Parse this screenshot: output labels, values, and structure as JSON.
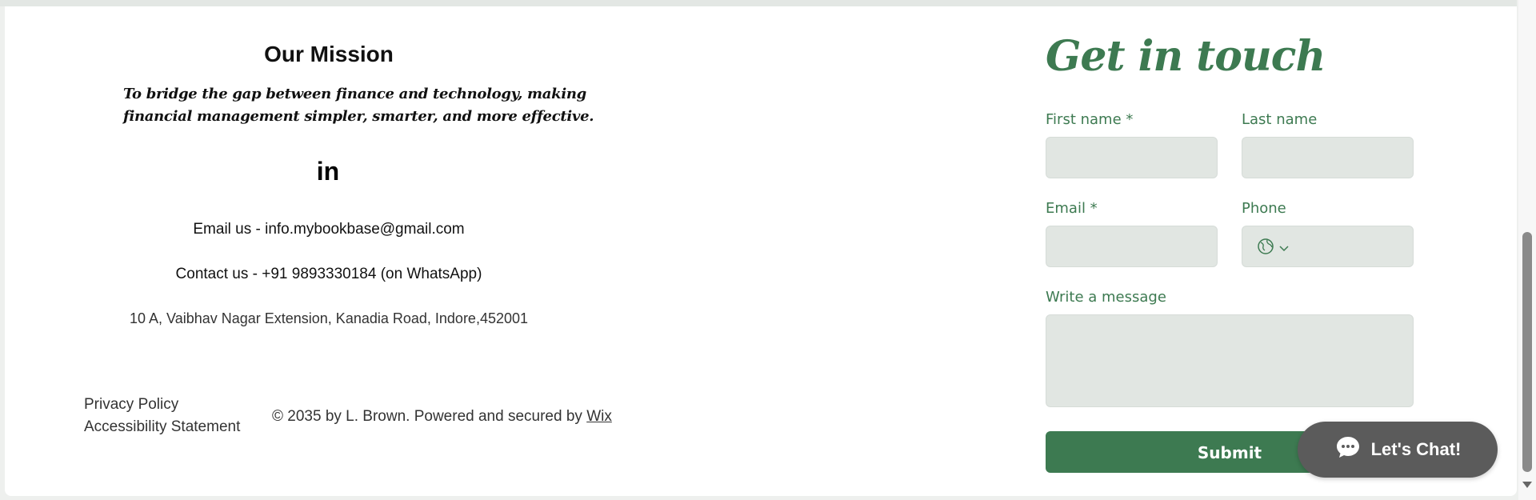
{
  "mission": {
    "title": "Our Mission",
    "text": "To bridge the gap between finance and technology, making financial management simpler, smarter, and more effective.",
    "linkedin_icon": "linkedin-icon",
    "email_line": "Email us - info.mybookbase@gmail.com",
    "contact_line": "Contact us - +91 9893330184  (on  WhatsApp)",
    "address": "10 A, Vaibhav Nagar Extension, Kanadia Road, Indore,452001"
  },
  "footer": {
    "privacy": "Privacy Policy",
    "accessibility": "Accessibility Statement",
    "copyright_prefix": "© 2035 by L. Brown. Powered and secured by ",
    "wix": "Wix"
  },
  "form": {
    "title": "Get in touch",
    "first_name_label": "First name *",
    "last_name_label": "Last name",
    "email_label": "Email *",
    "phone_label": "Phone",
    "message_label": "Write a message",
    "submit_label": "Submit",
    "phone_icons": [
      "globe-icon",
      "chevron-down-icon"
    ]
  },
  "chat": {
    "label": "Let's Chat!",
    "icon": "chat-bubble-icon"
  },
  "colors": {
    "accent": "#3d7a51",
    "field_bg": "#e1e6e2",
    "chat_bg": "#5b5b5b"
  }
}
